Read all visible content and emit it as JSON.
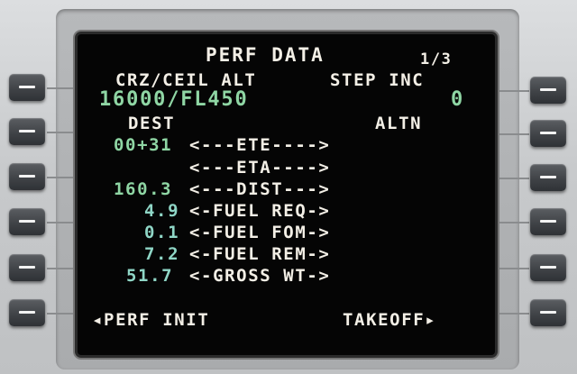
{
  "screen": {
    "title": "PERF DATA",
    "page": "1/3",
    "crz_ceil_label": "CRZ/CEIL ALT",
    "step_inc_label": "STEP INC",
    "crz_ceil_value": "16000/FL450",
    "step_inc_value": "0",
    "dest_label": "DEST",
    "altn_label": "ALTN",
    "rows": [
      {
        "value": "00+31",
        "label": "<---ETE---->"
      },
      {
        "value": "",
        "label": "<---ETA---->"
      },
      {
        "value": "160.3",
        "label": "<---DIST--->"
      },
      {
        "value": "4.9",
        "label": "<-FUEL REQ->"
      },
      {
        "value": "0.1",
        "label": "<-FUEL FOM->"
      },
      {
        "value": "7.2",
        "label": "<-FUEL REM->"
      },
      {
        "value": "51.7",
        "label": "<-GROSS WT->"
      }
    ],
    "left_bottom_prompt": "◂PERF INIT",
    "right_bottom_prompt": "TAKEOFF▸"
  },
  "colors": {
    "screen_bg": "#050505",
    "text_white": "#f3efe6",
    "text_green": "#8fd6a4",
    "key_face": "#3e4145",
    "bezel": "#c8cacc"
  },
  "icons": {
    "line_select_key": "dash-key"
  }
}
